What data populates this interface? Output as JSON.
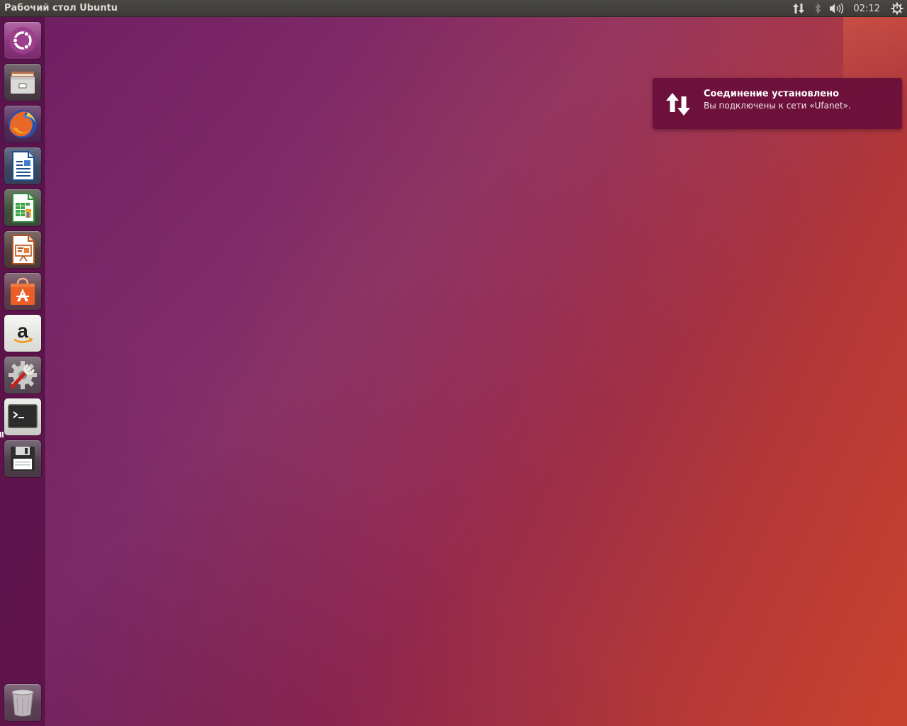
{
  "panel": {
    "title": "Рабочий стол Ubuntu",
    "indicators": [
      {
        "name": "network-updown-icon"
      },
      {
        "name": "bluetooth-icon"
      },
      {
        "name": "volume-icon"
      },
      {
        "name": "power-gear-icon"
      }
    ],
    "clock": "02:12"
  },
  "launcher": {
    "items": [
      {
        "name": "dash-home",
        "icon": "ubuntu-logo-icon"
      },
      {
        "name": "files",
        "icon": "file-cabinet-icon"
      },
      {
        "name": "firefox",
        "icon": "firefox-icon"
      },
      {
        "name": "libreoffice-writer",
        "icon": "writer-icon"
      },
      {
        "name": "libreoffice-calc",
        "icon": "calc-icon"
      },
      {
        "name": "libreoffice-impress",
        "icon": "impress-icon"
      },
      {
        "name": "software-center",
        "icon": "shopping-bag-icon"
      },
      {
        "name": "amazon",
        "icon": "amazon-icon"
      },
      {
        "name": "system-settings",
        "icon": "settings-wrench-icon"
      },
      {
        "name": "terminal",
        "icon": "terminal-icon",
        "running": true
      },
      {
        "name": "disk-save",
        "icon": "floppy-icon"
      },
      {
        "name": "trash",
        "icon": "trash-icon"
      }
    ]
  },
  "notification": {
    "icon": "network-updown-icon",
    "title": "Соединение установлено",
    "body": "Вы подключены к сети «Ufanet»."
  },
  "colors": {
    "panel": "#3c3b37",
    "notification": "#690e3a",
    "wallpaper_left": "#6e1f63",
    "wallpaper_right": "#c8432e"
  }
}
